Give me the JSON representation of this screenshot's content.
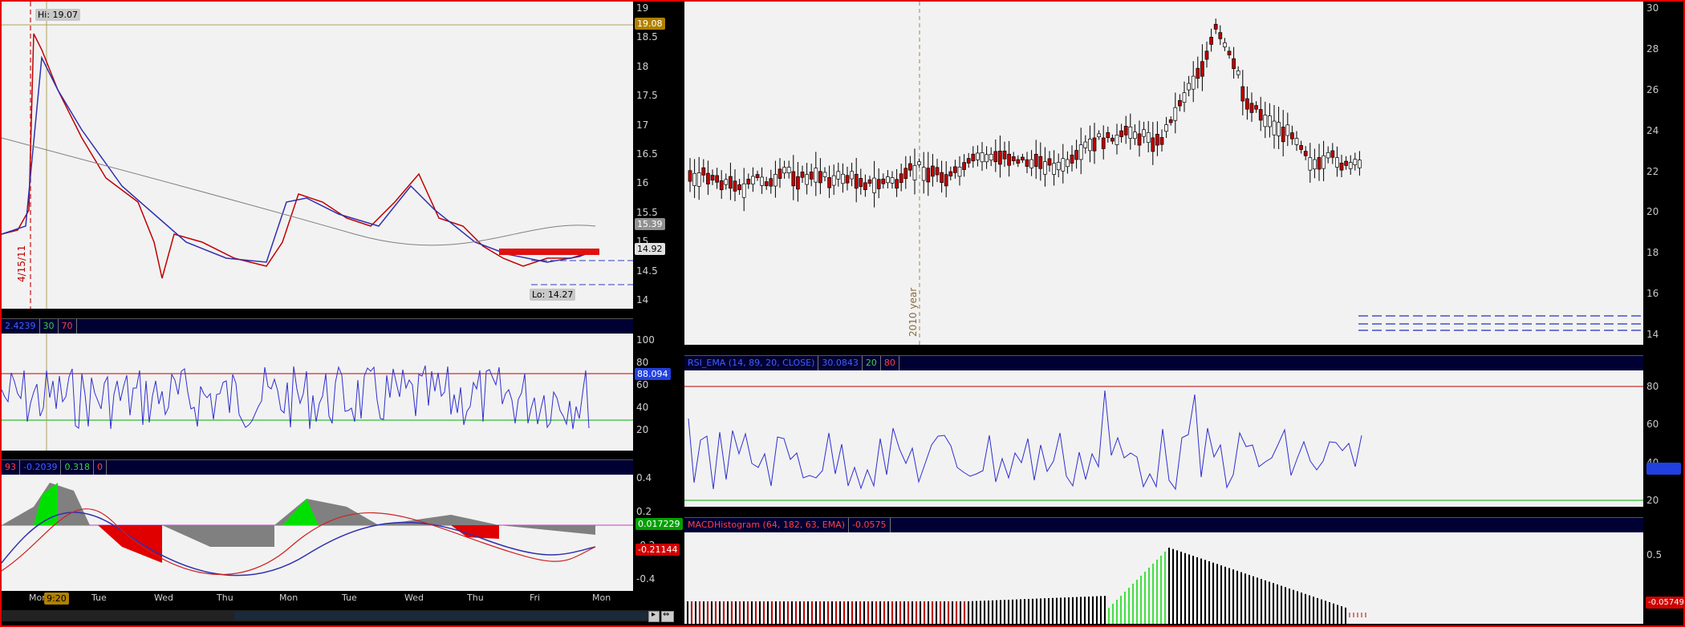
{
  "left_chart": {
    "price": {
      "hi_label": "Hi: 19.07",
      "lo_label": "Lo: 14.27",
      "date_marker": "4/15/11",
      "axis": [
        "19",
        "18.5",
        "18",
        "17.5",
        "17",
        "16.5",
        "16",
        "15.5",
        "15",
        "14.5",
        "14"
      ],
      "tags": {
        "top": "19.08",
        "mid": "15.39",
        "cur": "14.92"
      },
      "colors": {
        "up": "#ffffff",
        "down": "#c00000",
        "ma_fast": "#2f2fb0",
        "ma_slow": "#808080"
      }
    },
    "rsi": {
      "header": [
        "2.4239",
        "30",
        "70"
      ],
      "axis": [
        "100",
        "80",
        "60",
        "40",
        "20"
      ],
      "value_tag": "88.094"
    },
    "macd": {
      "header": [
        "93",
        "-0.2039",
        "0.318",
        "0"
      ],
      "axis": [
        "0.4",
        "0.2",
        "-0.2",
        "-0.4"
      ],
      "tags": {
        "hist": "0.017229",
        "line": "-0.21144"
      }
    },
    "time_axis": [
      "Mon",
      "Tue",
      "Wed",
      "Thu",
      "Mon",
      "Tue",
      "Wed",
      "Thu",
      "Fri",
      "Mon"
    ],
    "time_marker": "9:20"
  },
  "right_chart": {
    "price": {
      "axis": [
        "30",
        "28",
        "26",
        "24",
        "22",
        "20",
        "18",
        "16",
        "14"
      ],
      "year_marker": "2010 year"
    },
    "rsi": {
      "header": [
        "RSI_EMA (14, 89, 20, CLOSE)",
        "30.0843",
        "20",
        "80"
      ],
      "axis": [
        "80",
        "60",
        "40",
        "20"
      ],
      "value_tag": "30.0843"
    },
    "macd_hist": {
      "header": [
        "MACDHistogram (64, 182, 63, EMA)",
        "-0.0575"
      ],
      "axis": [
        "0.5",
        "0"
      ],
      "value_tag": "-0.05749"
    }
  }
}
